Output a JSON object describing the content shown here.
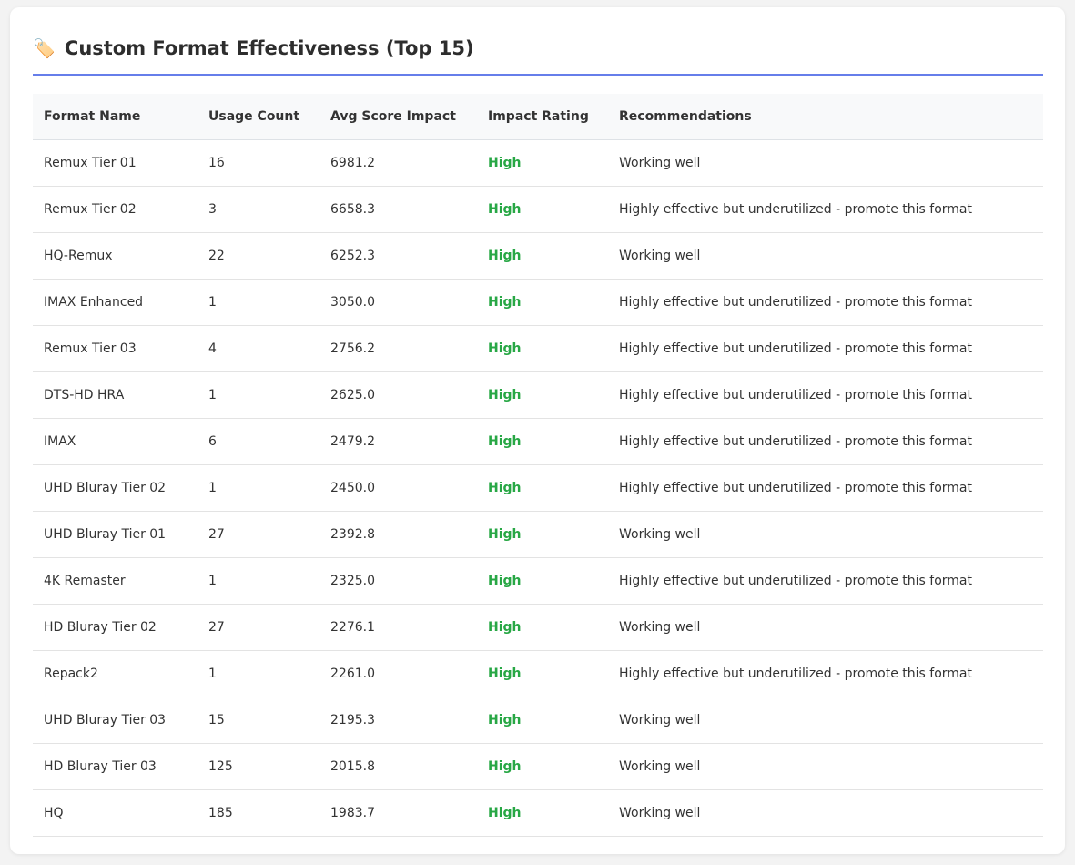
{
  "title": {
    "icon": "🏷️",
    "text": "Custom Format Effectiveness (Top 15)"
  },
  "colors": {
    "accent": "#667eea",
    "high": "#28a745"
  },
  "table": {
    "headers": [
      "Format Name",
      "Usage Count",
      "Avg Score Impact",
      "Impact Rating",
      "Recommendations"
    ],
    "rows": [
      [
        "Remux Tier 01",
        "16",
        "6981.2",
        "High",
        "Working well"
      ],
      [
        "Remux Tier 02",
        "3",
        "6658.3",
        "High",
        "Highly effective but underutilized - promote this format"
      ],
      [
        "HQ-Remux",
        "22",
        "6252.3",
        "High",
        "Working well"
      ],
      [
        "IMAX Enhanced",
        "1",
        "3050.0",
        "High",
        "Highly effective but underutilized - promote this format"
      ],
      [
        "Remux Tier 03",
        "4",
        "2756.2",
        "High",
        "Highly effective but underutilized - promote this format"
      ],
      [
        "DTS-HD HRA",
        "1",
        "2625.0",
        "High",
        "Highly effective but underutilized - promote this format"
      ],
      [
        "IMAX",
        "6",
        "2479.2",
        "High",
        "Highly effective but underutilized - promote this format"
      ],
      [
        "UHD Bluray Tier 02",
        "1",
        "2450.0",
        "High",
        "Highly effective but underutilized - promote this format"
      ],
      [
        "UHD Bluray Tier 01",
        "27",
        "2392.8",
        "High",
        "Working well"
      ],
      [
        "4K Remaster",
        "1",
        "2325.0",
        "High",
        "Highly effective but underutilized - promote this format"
      ],
      [
        "HD Bluray Tier 02",
        "27",
        "2276.1",
        "High",
        "Working well"
      ],
      [
        "Repack2",
        "1",
        "2261.0",
        "High",
        "Highly effective but underutilized - promote this format"
      ],
      [
        "UHD Bluray Tier 03",
        "15",
        "2195.3",
        "High",
        "Working well"
      ],
      [
        "HD Bluray Tier 03",
        "125",
        "2015.8",
        "High",
        "Working well"
      ],
      [
        "HQ",
        "185",
        "1983.7",
        "High",
        "Working well"
      ]
    ]
  }
}
